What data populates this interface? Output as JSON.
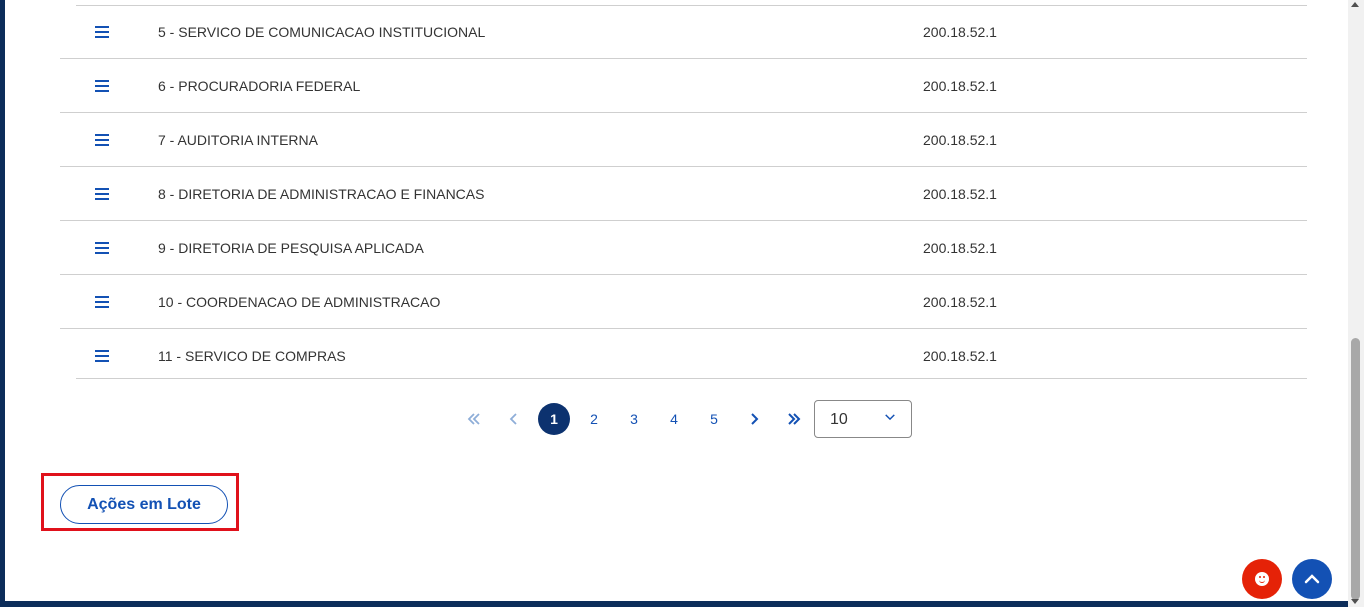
{
  "table": {
    "rows": [
      {
        "name": "5 - SERVICO DE COMUNICACAO INSTITUCIONAL",
        "ip": "200.18.52.1"
      },
      {
        "name": "6 - PROCURADORIA FEDERAL",
        "ip": "200.18.52.1"
      },
      {
        "name": "7 - AUDITORIA INTERNA",
        "ip": "200.18.52.1"
      },
      {
        "name": "8 - DIRETORIA DE ADMINISTRACAO E FINANCAS",
        "ip": "200.18.52.1"
      },
      {
        "name": "9 - DIRETORIA DE PESQUISA APLICADA",
        "ip": "200.18.52.1"
      },
      {
        "name": "10 - COORDENACAO DE ADMINISTRACAO",
        "ip": "200.18.52.1"
      },
      {
        "name": "11 - SERVICO DE COMPRAS",
        "ip": "200.18.52.1"
      }
    ]
  },
  "pagination": {
    "first_icon": "double-chevron-left-icon",
    "prev_icon": "chevron-left-icon",
    "next_icon": "chevron-right-icon",
    "last_icon": "double-chevron-right-icon",
    "pages": [
      "1",
      "2",
      "3",
      "4",
      "5"
    ],
    "current_page": "1",
    "page_size": "10",
    "page_size_icon": "chevron-down-icon"
  },
  "actions": {
    "batch_label": "Ações em Lote"
  },
  "floating": {
    "chat_icon": "smiley-icon",
    "scroll_top_icon": "chevron-up-icon"
  },
  "colors": {
    "primary": "#1351b4",
    "primary_dark": "#0c326f",
    "highlight": "#e0111b",
    "chat": "#e52207"
  }
}
